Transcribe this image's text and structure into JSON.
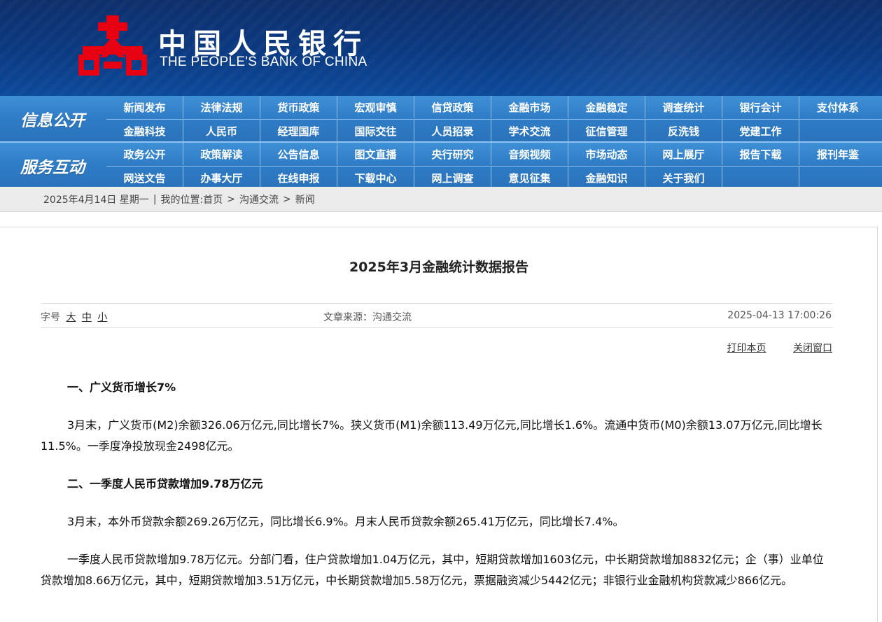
{
  "header": {
    "title_cn": "中国人民银行",
    "title_en": "THE PEOPLE'S BANK OF CHINA",
    "logo_icon": "pboc-logo-icon",
    "colors": {
      "banner": "#0b3a82",
      "logo_red": "#e60012",
      "nav": "#2f7cc6"
    }
  },
  "nav": {
    "info": {
      "title": "信息公开",
      "row1": [
        "新闻发布",
        "法律法规",
        "货币政策",
        "宏观审慎",
        "信贷政策",
        "金融市场",
        "金融稳定",
        "调查统计",
        "银行会计",
        "支付体系"
      ],
      "row2": [
        "金融科技",
        "人民币",
        "经理国库",
        "国际交往",
        "人员招录",
        "学术交流",
        "征信管理",
        "反洗钱",
        "党建工作"
      ]
    },
    "service": {
      "title": "服务互动",
      "row1": [
        "政务公开",
        "政策解读",
        "公告信息",
        "图文直播",
        "央行研究",
        "音频视频",
        "市场动态",
        "网上展厅",
        "报告下载",
        "报刊年鉴"
      ],
      "row2": [
        "网送文告",
        "办事大厅",
        "在线申报",
        "下载中心",
        "网上调查",
        "意见征集",
        "金融知识",
        "关于我们"
      ]
    }
  },
  "breadcrumb": {
    "date": "2025年4月14日 星期一",
    "label": "我的位置:",
    "items": [
      "首页",
      "沟通交流",
      "新闻"
    ]
  },
  "article": {
    "title": "2025年3月金融统计数据报告",
    "font_size_label": "字号",
    "font_sizes": [
      "大",
      "中",
      "小"
    ],
    "source": "文章来源：沟通交流",
    "datetime": "2025-04-13 17:00:26",
    "print": "打印本页",
    "close": "关闭窗口",
    "sections": [
      {
        "heading": "一、广义货币增长7%",
        "paragraphs": [
          "3月末，广义货币(M2)余额326.06万亿元,同比增长7%。狭义货币(M1)余额113.49万亿元,同比增长1.6%。流通中货币(M0)余额13.07万亿元,同比增长11.5%。一季度净投放现金2498亿元。"
        ]
      },
      {
        "heading": "二、一季度人民币贷款增加9.78万亿元",
        "paragraphs": [
          "3月末，本外币贷款余额269.26万亿元，同比增长6.9%。月末人民币贷款余额265.41万亿元，同比增长7.4%。",
          "一季度人民币贷款增加9.78万亿元。分部门看，住户贷款增加1.04万亿元，其中，短期贷款增加1603亿元，中长期贷款增加8832亿元；企（事）业单位贷款增加8.66万亿元，其中，短期贷款增加3.51万亿元，中长期贷款增加5.58万亿元，票据融资减少5442亿元；非银行业金融机构贷款减少866亿元。"
        ]
      }
    ]
  }
}
